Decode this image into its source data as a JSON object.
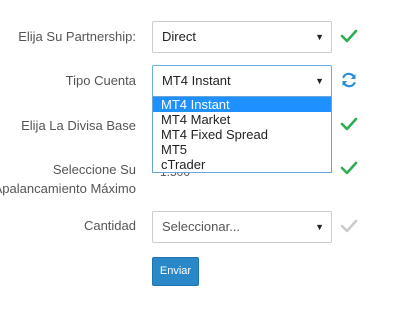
{
  "form": {
    "partnership": {
      "label": "Elija Su Partnership:",
      "value": "Direct",
      "status": "check",
      "status_color": "#2eae4f"
    },
    "account_type": {
      "label": "Tipo Cuenta",
      "value": "MT4 Instant",
      "status": "refresh",
      "status_color": "#2a8fd6",
      "dropdown_open": true,
      "options": [
        "MT4 Instant",
        "MT4 Market",
        "MT4 Fixed Spread",
        "MT5",
        "cTrader"
      ],
      "selected_option": "MT4 Instant"
    },
    "base_currency": {
      "label": "Elija La Divisa Base",
      "status": "check",
      "status_color": "#2eae4f"
    },
    "leverage": {
      "label_line1": "Seleccione Su",
      "label_line2": "Apalancamiento Máximo",
      "value_partial": "1:500",
      "status": "check",
      "status_color": "#2eae4f"
    },
    "amount": {
      "label": "Cantidad",
      "value": "Seleccionar...",
      "status": "check",
      "status_color": "#cccccc"
    },
    "submit_label": "Enviar",
    "submit_color": "#2a88c9"
  }
}
